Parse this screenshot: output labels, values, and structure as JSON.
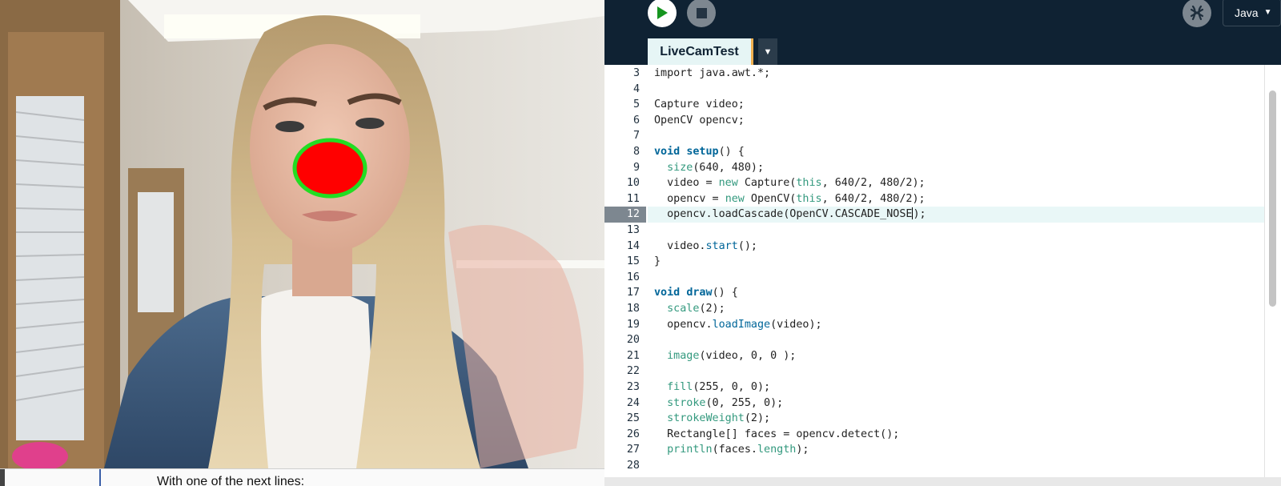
{
  "cam_window": {
    "document_text": "With one of the next lines:"
  },
  "ide": {
    "toolbar": {
      "run_icon": "play-icon",
      "stop_icon": "stop-icon",
      "mode_icon": "debugger-icon",
      "mode_label": "Java",
      "mode_caret": "▼"
    },
    "tab": {
      "label": "LiveCamTest",
      "menu_glyph": "▼"
    },
    "editor": {
      "current_line": 12,
      "line_numbers": [
        "3",
        "4",
        "5",
        "6",
        "7",
        "8",
        "9",
        "10",
        "11",
        "12",
        "13",
        "14",
        "15",
        "16",
        "17",
        "18",
        "19",
        "20",
        "21",
        "22",
        "23",
        "24",
        "25",
        "26",
        "27",
        "28"
      ],
      "lines": [
        [
          {
            "t": "import java.awt.*;",
            "c": ""
          }
        ],
        [],
        [
          {
            "t": "Capture video;",
            "c": ""
          }
        ],
        [
          {
            "t": "OpenCV opencv;",
            "c": ""
          }
        ],
        [],
        [
          {
            "t": "void ",
            "c": "kw-bold-void"
          },
          {
            "t": "setup",
            "c": "kw-bold"
          },
          {
            "t": "() {",
            "c": ""
          }
        ],
        [
          {
            "t": "  ",
            "c": ""
          },
          {
            "t": "size",
            "c": "kw"
          },
          {
            "t": "(640, 480);",
            "c": ""
          }
        ],
        [
          {
            "t": "  video = ",
            "c": ""
          },
          {
            "t": "new",
            "c": "kw"
          },
          {
            "t": " Capture(",
            "c": ""
          },
          {
            "t": "this",
            "c": "kw"
          },
          {
            "t": ", 640/2, 480/2);",
            "c": ""
          }
        ],
        [
          {
            "t": "  opencv = ",
            "c": ""
          },
          {
            "t": "new",
            "c": "kw"
          },
          {
            "t": " OpenCV(",
            "c": ""
          },
          {
            "t": "this",
            "c": "kw"
          },
          {
            "t": ", 640/2, 480/2);",
            "c": ""
          }
        ],
        [
          {
            "t": "  opencv.loadCascade(OpenCV.CASCADE_NOSE",
            "c": ""
          },
          {
            "t": "|",
            "c": "caret"
          },
          {
            "t": ");",
            "c": ""
          }
        ],
        [],
        [
          {
            "t": "  video.",
            "c": ""
          },
          {
            "t": "start",
            "c": "fn"
          },
          {
            "t": "();",
            "c": ""
          }
        ],
        [
          {
            "t": "}",
            "c": ""
          }
        ],
        [],
        [
          {
            "t": "void ",
            "c": "kw-bold-void"
          },
          {
            "t": "draw",
            "c": "kw-bold"
          },
          {
            "t": "() {",
            "c": ""
          }
        ],
        [
          {
            "t": "  ",
            "c": ""
          },
          {
            "t": "scale",
            "c": "kw"
          },
          {
            "t": "(2);",
            "c": ""
          }
        ],
        [
          {
            "t": "  opencv.",
            "c": ""
          },
          {
            "t": "loadImage",
            "c": "fn"
          },
          {
            "t": "(video);",
            "c": ""
          }
        ],
        [],
        [
          {
            "t": "  ",
            "c": ""
          },
          {
            "t": "image",
            "c": "kw"
          },
          {
            "t": "(video, 0, 0 );",
            "c": ""
          }
        ],
        [],
        [
          {
            "t": "  ",
            "c": ""
          },
          {
            "t": "fill",
            "c": "kw"
          },
          {
            "t": "(255, 0, 0);",
            "c": ""
          }
        ],
        [
          {
            "t": "  ",
            "c": ""
          },
          {
            "t": "stroke",
            "c": "kw"
          },
          {
            "t": "(0, 255, 0);",
            "c": ""
          }
        ],
        [
          {
            "t": "  ",
            "c": ""
          },
          {
            "t": "strokeWeight",
            "c": "kw"
          },
          {
            "t": "(2);",
            "c": ""
          }
        ],
        [
          {
            "t": "  Rectangle[] faces = opencv.detect();",
            "c": ""
          }
        ],
        [
          {
            "t": "  ",
            "c": ""
          },
          {
            "t": "println",
            "c": "kw"
          },
          {
            "t": "(faces.",
            "c": ""
          },
          {
            "t": "length",
            "c": "kw"
          },
          {
            "t": ");",
            "c": ""
          }
        ],
        []
      ]
    }
  },
  "colors": {
    "ide_bg": "#0f2233",
    "tab_bg": "#e6f5f5",
    "tab_accent": "#f0b050",
    "keyword_bold": "#006699",
    "keyword": "#33997e",
    "current_line_bg": "#e9f7f7",
    "nose_fill": "#ff0000",
    "nose_stroke": "#22dd22"
  }
}
